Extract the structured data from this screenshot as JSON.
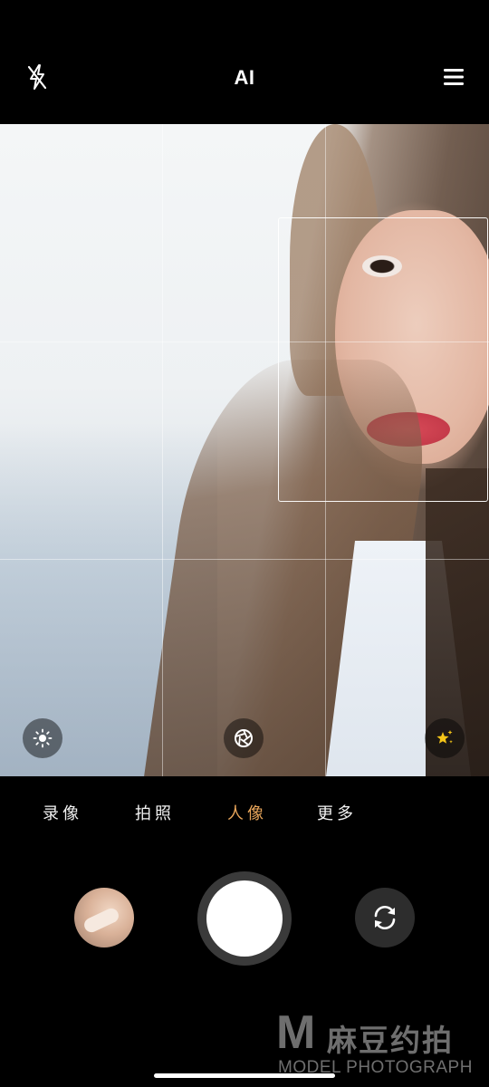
{
  "topbar": {
    "flash_icon": "flash-off-icon",
    "ai_label": "AI",
    "menu_icon": "hamburger-menu-icon"
  },
  "viewfinder": {
    "grid": "3x3",
    "face_detection_box": true,
    "controls": {
      "left_icon": "exposure-sun-icon",
      "center_icon": "aperture-icon",
      "right_icon": "beauty-star-icon"
    }
  },
  "modes": {
    "items": [
      {
        "label": "录像",
        "active": false
      },
      {
        "label": "拍照",
        "active": false
      },
      {
        "label": "人像",
        "active": true
      },
      {
        "label": "更多",
        "active": false
      }
    ],
    "active_color": "#e8a55a"
  },
  "bottom": {
    "gallery_icon": "gallery-thumbnail",
    "shutter_icon": "shutter-button",
    "switch_icon": "switch-camera-icon"
  },
  "watermark": {
    "logo": "M",
    "name_cn": "麻豆约拍",
    "name_en": "MODEL PHOTOGRAPH"
  }
}
